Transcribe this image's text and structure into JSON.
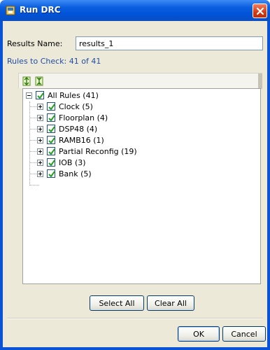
{
  "window": {
    "title": "Run DRC"
  },
  "form": {
    "results_name_label": "Results Name:",
    "results_name_value": "results_1",
    "rules_count_label": "Rules to Check: 41 of 41"
  },
  "toolbar": {
    "expand_icon": "expand-all-icon",
    "collapse_icon": "collapse-all-icon"
  },
  "tree": {
    "root": {
      "label": "All Rules (41)",
      "checked": true,
      "expanded": true
    },
    "items": [
      {
        "label": "Clock (5)",
        "checked": true
      },
      {
        "label": "Floorplan (4)",
        "checked": true
      },
      {
        "label": "DSP48 (4)",
        "checked": true
      },
      {
        "label": "RAMB16 (1)",
        "checked": true
      },
      {
        "label": "Partial Reconfig (19)",
        "checked": true
      },
      {
        "label": "IOB (3)",
        "checked": true
      },
      {
        "label": "Bank (5)",
        "checked": true
      }
    ]
  },
  "buttons": {
    "select_all": "Select All",
    "clear_all": "Clear All",
    "ok": "OK",
    "cancel": "Cancel"
  },
  "colors": {
    "title_bar": "#0a52d6",
    "close_button": "#d63a12",
    "dialog_bg": "#ece9d8",
    "rules_count_text": "#1f4ea8",
    "checkbox_check": "#21a121"
  }
}
